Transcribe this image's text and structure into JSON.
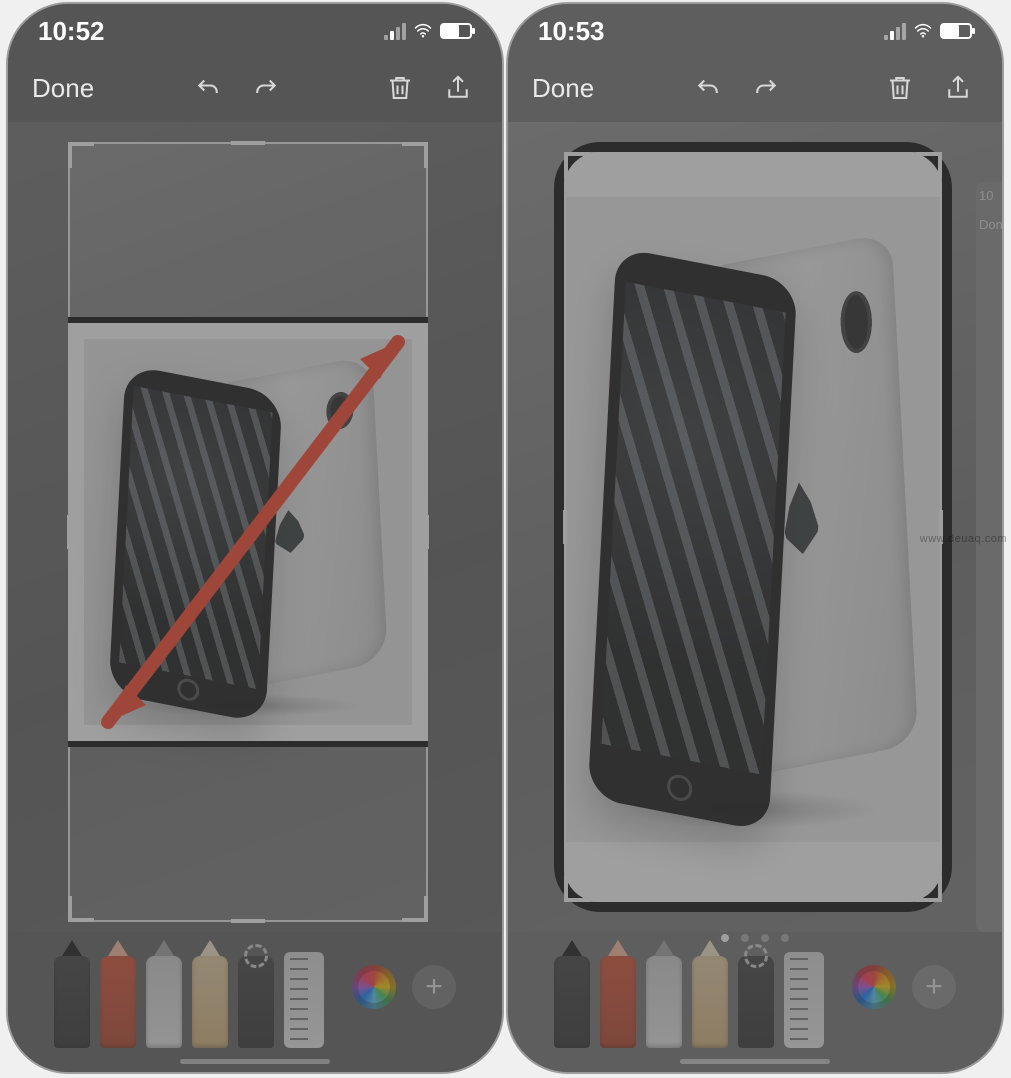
{
  "watermark": "www.deuaq.com",
  "left": {
    "status": {
      "time": "10:52"
    },
    "toolbar": {
      "done_label": "Done",
      "icons": {
        "undo": "undo-icon",
        "redo": "redo-icon",
        "trash": "trash-icon",
        "share": "share-icon"
      }
    },
    "markup_tools": [
      "pen",
      "marker",
      "pencil",
      "eraser",
      "lasso",
      "ruler",
      "color",
      "add"
    ],
    "arrow_color": "#fe3b1f"
  },
  "right": {
    "status": {
      "time": "10:53"
    },
    "toolbar": {
      "done_label": "Done",
      "icons": {
        "undo": "undo-icon",
        "redo": "redo-icon",
        "trash": "trash-icon",
        "share": "share-icon"
      }
    },
    "float_panel": {
      "time": "10",
      "label": "Don"
    },
    "page_dots": {
      "count": 4,
      "active_index": 0
    },
    "markup_tools": [
      "pen",
      "marker",
      "pencil",
      "eraser",
      "lasso",
      "ruler",
      "color",
      "add"
    ]
  }
}
